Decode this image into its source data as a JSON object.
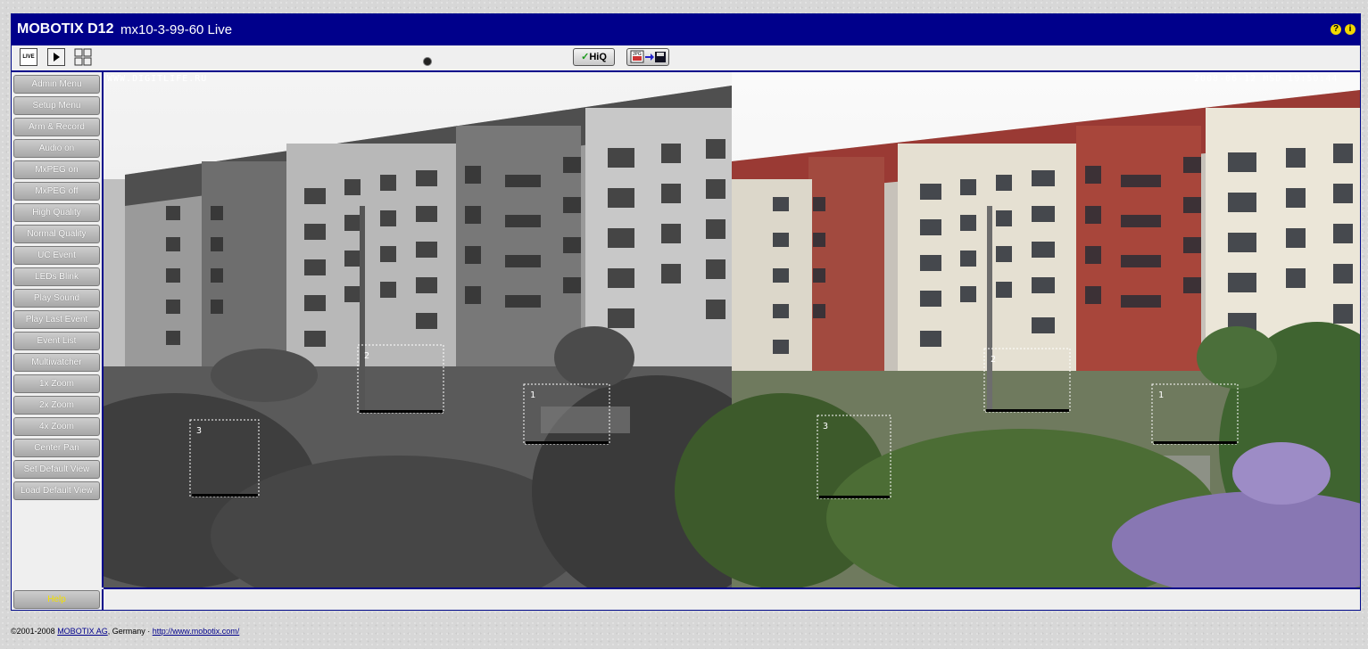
{
  "header": {
    "brand": "MOBOTIX D12",
    "subtitle": "mx10-3-99-60 Live",
    "icons": [
      "help-icon",
      "info-icon"
    ]
  },
  "toolbar": {
    "live_label": "LIVE",
    "hiq_label": "HiQ",
    "icons": [
      "live-icon",
      "play-icon",
      "multiview-icon",
      "status-dot-icon",
      "jpg-save-icon"
    ]
  },
  "sidebar": {
    "items": [
      {
        "label": "Admin Menu"
      },
      {
        "label": "Setup Menu"
      },
      {
        "label": "Arm & Record"
      },
      {
        "label": "Audio on"
      },
      {
        "label": "MxPEG on"
      },
      {
        "label": "MxPEG off"
      },
      {
        "label": "High Quality"
      },
      {
        "label": "Normal Quality"
      },
      {
        "label": "UC Event"
      },
      {
        "label": "LEDs Blink"
      },
      {
        "label": "Play Sound"
      },
      {
        "label": "Play Last Event"
      },
      {
        "label": "Event List"
      },
      {
        "label": "Multiwatcher"
      },
      {
        "label": "1x Zoom"
      },
      {
        "label": "2x Zoom"
      },
      {
        "label": "4x Zoom"
      },
      {
        "label": "Center Pan"
      },
      {
        "label": "Set Default View"
      },
      {
        "label": "Load Default View"
      }
    ],
    "help_label": "Help"
  },
  "camera": {
    "watermark": "WWW.DIGITLIFE.RU",
    "timestamp": "2008-06-12 MSD 19:50:44",
    "zones_left": [
      "2",
      "1",
      "3"
    ],
    "zones_right": [
      "2",
      "1",
      "3"
    ]
  },
  "footer": {
    "copyright": "©2001-2008",
    "company_link": "MOBOTIX AG",
    "country": ", Germany · ",
    "url_link": "http://www.mobotix.com/"
  },
  "colors": {
    "header_bg": "#00008b",
    "help_text": "#f3e000",
    "link": "#00008b"
  }
}
